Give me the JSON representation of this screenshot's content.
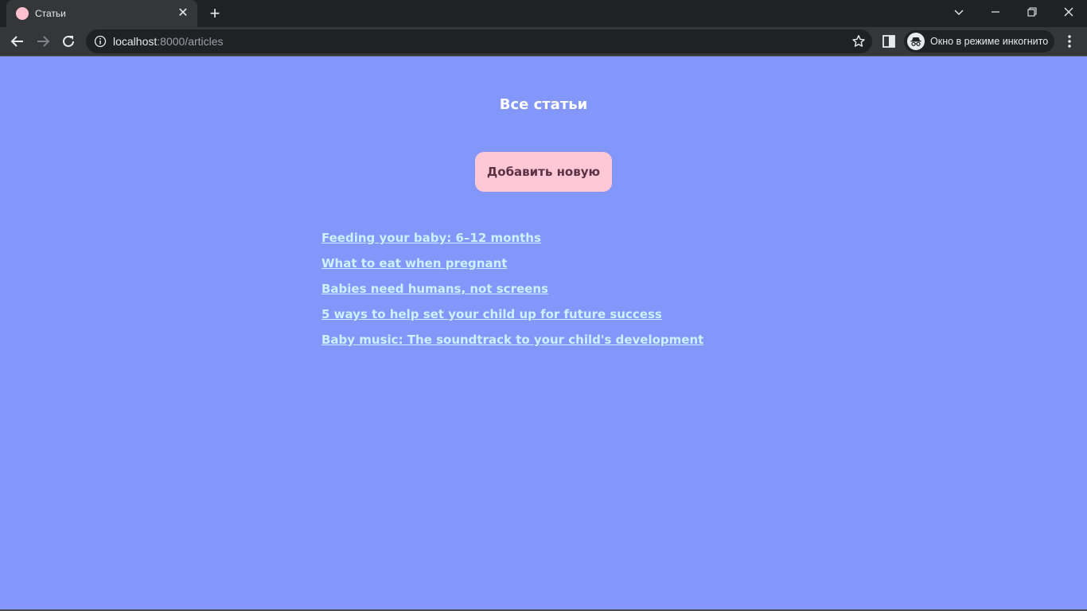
{
  "browser": {
    "tab": {
      "title": "Статьи",
      "close": "✕"
    },
    "new_tab": "+",
    "address": {
      "host": "localhost",
      "path": ":8000/articles"
    },
    "incognito_label": "Окно в режиме инкогнито"
  },
  "page": {
    "title": "Все статьи",
    "add_button": "Добавить новую",
    "articles": [
      "Feeding your baby: 6–12 months",
      "What to eat when pregnant",
      "Babies need humans, not screens",
      "5 ways to help set your child up for future success",
      "Baby music: The soundtrack to your child's development"
    ]
  },
  "colors": {
    "page_background": "#8396f9",
    "button_background": "#ffc8d6",
    "button_text": "#5c3144",
    "link": "#cdf1ff"
  }
}
